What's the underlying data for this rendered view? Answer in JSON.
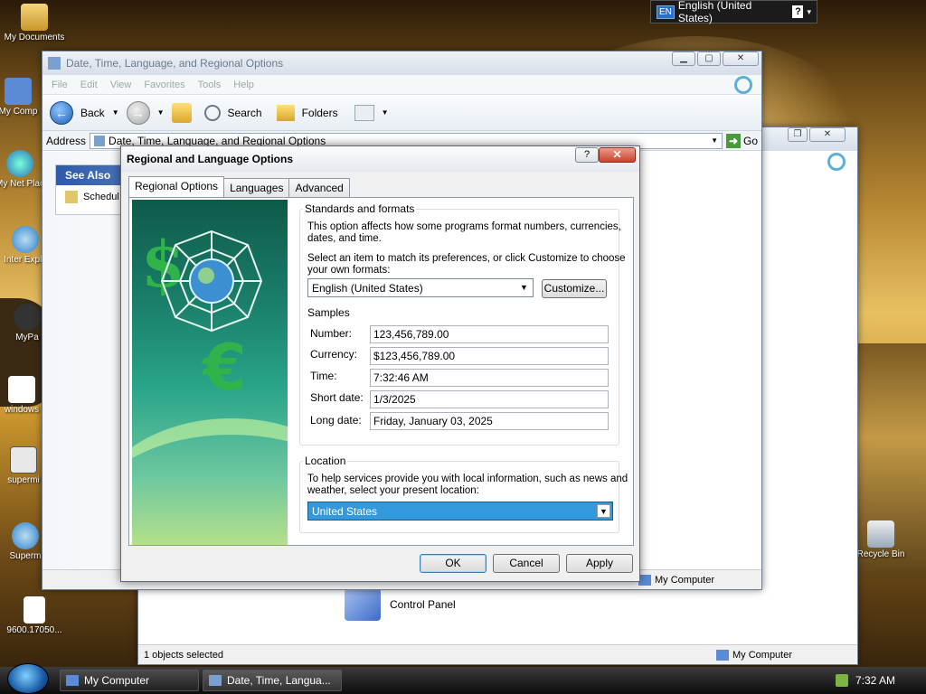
{
  "language_bar": {
    "code": "EN",
    "language": "English (United States)",
    "help": "?"
  },
  "desktop_icons": [
    "My Documents",
    "My Comp",
    "My Net Plac",
    "Inter Explo",
    "MyPa",
    "windows",
    "supermi",
    "Superm",
    "9600.17050...",
    "Recycle Bin"
  ],
  "back_window": {
    "address_go": "Go",
    "item_label": "Control Panel",
    "status_left": "1 objects selected",
    "status_right": "My Computer"
  },
  "front_window": {
    "title": "Date, Time, Language, and Regional Options",
    "menu": [
      "File",
      "Edit",
      "View",
      "Favorites",
      "Tools",
      "Help"
    ],
    "toolbar": {
      "back": "Back",
      "search": "Search",
      "folders": "Folders"
    },
    "address_label": "Address",
    "address_value": "Date, Time, Language, and Regional Options",
    "address_go": "Go",
    "see_also": "See Also",
    "see_also_item": "Schedul",
    "status_right": "My Computer"
  },
  "dialog": {
    "title": "Regional and Language Options",
    "help": "?",
    "close": "✕",
    "tabs": [
      "Regional Options",
      "Languages",
      "Advanced"
    ],
    "standards": {
      "legend": "Standards and formats",
      "desc1": "This option affects how some programs format numbers, currencies,",
      "desc2": "dates, and time.",
      "select1": "Select an item to match its preferences, or click Customize to choose",
      "select2": "your own formats:",
      "selected": "English (United States)",
      "customize": "Customize..."
    },
    "samples": {
      "title": "Samples",
      "rows": [
        {
          "label": "Number:",
          "value": "123,456,789.00"
        },
        {
          "label": "Currency:",
          "value": "$123,456,789.00"
        },
        {
          "label": "Time:",
          "value": "7:32:46 AM"
        },
        {
          "label": "Short date:",
          "value": "1/3/2025"
        },
        {
          "label": "Long date:",
          "value": "Friday, January 03, 2025"
        }
      ]
    },
    "location": {
      "legend": "Location",
      "desc1": "To help services provide you with local information, such as news and",
      "desc2": "weather, select your present location:",
      "selected": "United States"
    },
    "buttons": {
      "ok": "OK",
      "cancel": "Cancel",
      "apply": "Apply"
    }
  },
  "taskbar": {
    "items": [
      "My Computer",
      "Date, Time, Langua..."
    ],
    "clock": "7:32 AM"
  }
}
